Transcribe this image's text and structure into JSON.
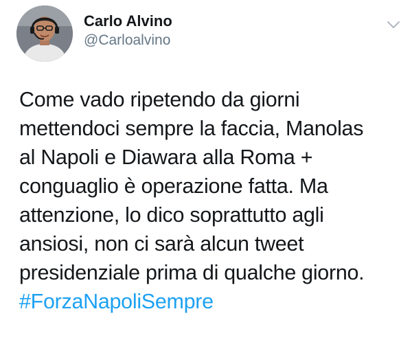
{
  "tweet": {
    "author": {
      "display_name": "Carlo Alvino",
      "handle": "@Carloalvino"
    },
    "text_lines": [
      "Come vado ripetendo da giorni",
      "mettendoci sempre la faccia, Manolas",
      "al Napoli e Diawara alla Roma +",
      "conguaglio è operazione fatta. Ma",
      "attenzione, lo dico soprattutto agli",
      "ansiosi, non ci sarà alcun tweet",
      "presidenziale prima di qualche giorno."
    ],
    "hashtag": "#ForzaNapoliSempre",
    "icons": {
      "menu": "chevron-down-icon",
      "avatar": "profile-photo"
    },
    "colors": {
      "text": "#14171a",
      "handle": "#657786",
      "link": "#1da1f2",
      "caret": "#b0b8c0"
    }
  }
}
